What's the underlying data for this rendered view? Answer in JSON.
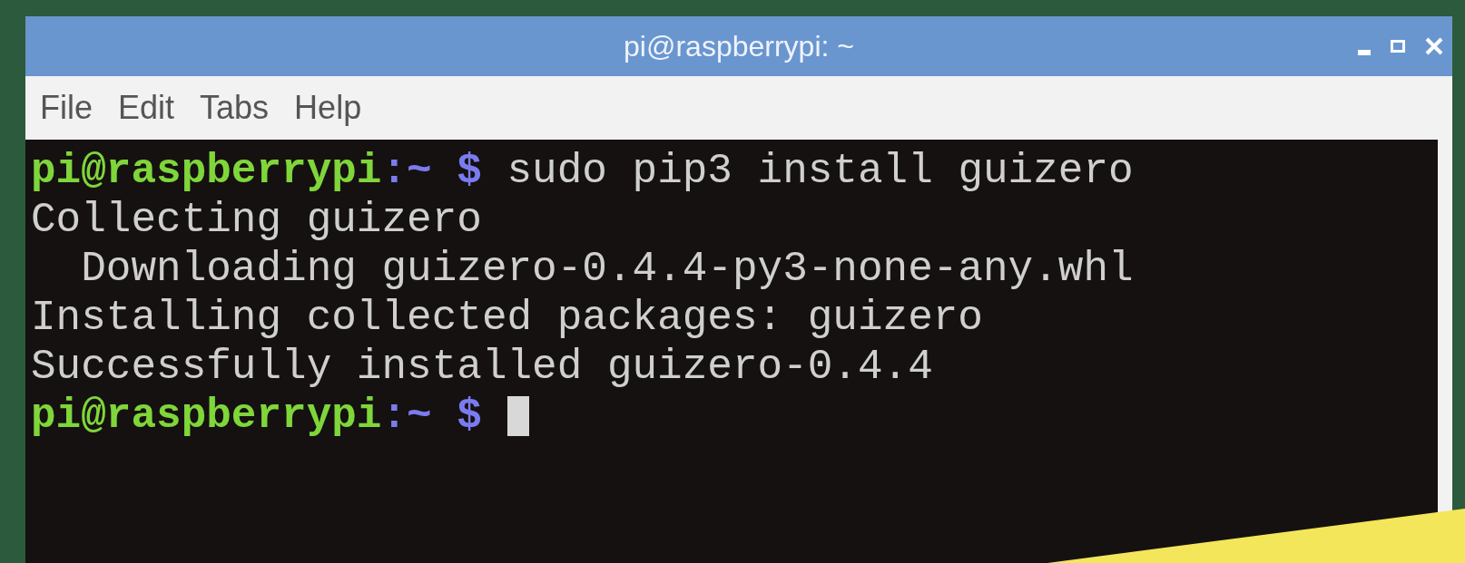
{
  "window": {
    "title": "pi@raspberrypi: ~"
  },
  "menu": [
    "File",
    "Edit",
    "Tabs",
    "Help"
  ],
  "terminal": {
    "lines": [
      {
        "kind": "prompt",
        "user": "pi@raspberrypi",
        "path": ":~",
        "symbol": "$",
        "command": "sudo pip3 install guizero",
        "cursor": false
      },
      {
        "kind": "output",
        "text": "Collecting guizero"
      },
      {
        "kind": "output",
        "text": "  Downloading guizero-0.4.4-py3-none-any.whl"
      },
      {
        "kind": "output",
        "text": "Installing collected packages: guizero"
      },
      {
        "kind": "output",
        "text": "Successfully installed guizero-0.4.4"
      },
      {
        "kind": "prompt",
        "user": "pi@raspberrypi",
        "path": ":~",
        "symbol": "$",
        "cursor": true
      }
    ]
  }
}
